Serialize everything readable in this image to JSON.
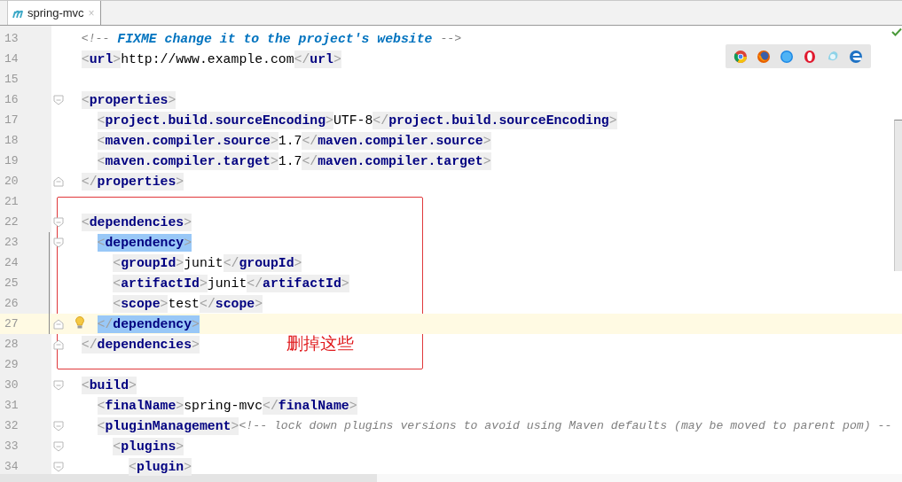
{
  "tabs": [
    {
      "label": "spring-mvc",
      "close": "×",
      "selected": true
    }
  ],
  "editor": {
    "lines": [
      {
        "number": "13",
        "tokens": [
          {
            "kind": "comment",
            "text": "  <!--"
          },
          {
            "kind": "todo",
            "text": " FIXME change it to the project's website "
          },
          {
            "kind": "comment",
            "text": "-->"
          }
        ]
      },
      {
        "number": "14",
        "tokens": [
          {
            "kind": "tag",
            "text": "  <url>"
          },
          {
            "kind": "text",
            "text": "http://www.example.com"
          },
          {
            "kind": "tag",
            "text": "</url>"
          }
        ]
      },
      {
        "number": "15"
      },
      {
        "number": "16",
        "fold_marker": {
          "kind": "start"
        },
        "tokens": [
          {
            "kind": "tag",
            "text": "  <properties>"
          }
        ]
      },
      {
        "number": "17",
        "tokens": [
          {
            "kind": "tag",
            "text": "    <project.build.sourceEncoding>"
          },
          {
            "kind": "text",
            "text": "UTF-8"
          },
          {
            "kind": "tag",
            "text": "</project.build.sourceEncoding>"
          }
        ]
      },
      {
        "number": "18",
        "tokens": [
          {
            "kind": "tag",
            "text": "    <maven.compiler.source>"
          },
          {
            "kind": "text",
            "text": "1.7"
          },
          {
            "kind": "tag",
            "text": "</maven.compiler.source>"
          }
        ]
      },
      {
        "number": "19",
        "tokens": [
          {
            "kind": "tag",
            "text": "    <maven.compiler.target>"
          },
          {
            "kind": "text",
            "text": "1.7"
          },
          {
            "kind": "tag",
            "text": "</maven.compiler.target>"
          }
        ]
      },
      {
        "number": "20",
        "fold_marker": {
          "kind": "end"
        },
        "tokens": [
          {
            "kind": "tag",
            "text": "  </properties>"
          }
        ]
      },
      {
        "number": "21"
      },
      {
        "number": "22",
        "fold_marker": {
          "kind": "start"
        },
        "tokens": [
          {
            "kind": "tag",
            "text": "  <dependencies>"
          }
        ]
      },
      {
        "number": "23",
        "fold_marker": {
          "kind": "start"
        },
        "changed": true,
        "tokens": [
          {
            "kind": "tag",
            "text": "    <dependency>",
            "matched": true
          }
        ]
      },
      {
        "number": "24",
        "changed": true,
        "tokens": [
          {
            "kind": "tag",
            "text": "      <groupId>"
          },
          {
            "kind": "text",
            "text": "junit"
          },
          {
            "kind": "tag",
            "text": "</groupId>"
          }
        ]
      },
      {
        "number": "25",
        "changed": true,
        "tokens": [
          {
            "kind": "tag",
            "text": "      <artifactId>"
          },
          {
            "kind": "text",
            "text": "junit"
          },
          {
            "kind": "tag",
            "text": "</artifactId>"
          }
        ]
      },
      {
        "number": "26",
        "changed": true,
        "tokens": [
          {
            "kind": "tag",
            "text": "      <scope>"
          },
          {
            "kind": "text",
            "text": "test"
          },
          {
            "kind": "tag",
            "text": "</scope>"
          }
        ]
      },
      {
        "number": "27",
        "fold_marker": {
          "kind": "end"
        },
        "changed": true,
        "current": true,
        "bulb": true,
        "tokens": [
          {
            "kind": "tag",
            "text": "    </dependency>",
            "matched": true
          }
        ]
      },
      {
        "number": "28",
        "fold_marker": {
          "kind": "end"
        },
        "tokens": [
          {
            "kind": "tag",
            "text": "  </dependencies>"
          }
        ]
      },
      {
        "number": "29"
      },
      {
        "number": "30",
        "fold_marker": {
          "kind": "start"
        },
        "tokens": [
          {
            "kind": "tag",
            "text": "  <build>"
          }
        ]
      },
      {
        "number": "31",
        "tokens": [
          {
            "kind": "tag",
            "text": "    <finalName>"
          },
          {
            "kind": "text",
            "text": "spring-mvc"
          },
          {
            "kind": "tag",
            "text": "</finalName>"
          }
        ]
      },
      {
        "number": "32",
        "fold_marker": {
          "kind": "start"
        },
        "tokens": [
          {
            "kind": "tag",
            "text": "    <pluginManagement>"
          },
          {
            "kind": "comment",
            "text": "<!-- lock down plugins versions to avoid using Maven defaults (may be moved to parent pom) --"
          }
        ]
      },
      {
        "number": "33",
        "fold_marker": {
          "kind": "start"
        },
        "tokens": [
          {
            "kind": "tag",
            "text": "      <plugins>"
          }
        ]
      },
      {
        "number": "34",
        "fold_marker": {
          "kind": "start"
        },
        "tokens": [
          {
            "kind": "tag",
            "text": "        <plugin>"
          }
        ]
      }
    ]
  },
  "annotation": {
    "text": "删掉这些"
  }
}
